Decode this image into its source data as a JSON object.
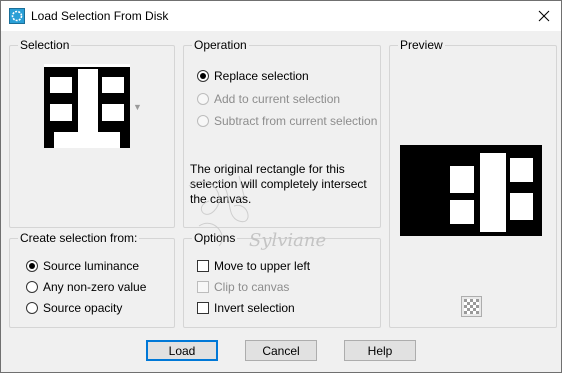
{
  "window": {
    "title": "Load Selection From Disk",
    "icon": "selection-dialog-icon"
  },
  "selection_group": {
    "label": "Selection"
  },
  "operation_group": {
    "label": "Operation",
    "options": [
      {
        "label": "Replace selection",
        "checked": true,
        "enabled": true
      },
      {
        "label": "Add to current selection",
        "checked": false,
        "enabled": false
      },
      {
        "label": "Subtract from current selection",
        "checked": false,
        "enabled": false
      }
    ],
    "info": "The original rectangle for this selection will completely intersect the canvas."
  },
  "preview_group": {
    "label": "Preview",
    "checker_icon": "transparency-checker-icon"
  },
  "create_group": {
    "label": "Create selection from:",
    "options": [
      {
        "label": "Source luminance",
        "checked": true
      },
      {
        "label": "Any non-zero value",
        "checked": false
      },
      {
        "label": "Source opacity",
        "checked": false
      }
    ]
  },
  "options_group": {
    "label": "Options",
    "items": [
      {
        "label": "Move to upper left",
        "checked": false,
        "enabled": true
      },
      {
        "label": "Clip to canvas",
        "checked": false,
        "enabled": false
      },
      {
        "label": "Invert selection",
        "checked": false,
        "enabled": true
      }
    ]
  },
  "buttons": {
    "load": "Load",
    "cancel": "Cancel",
    "help": "Help"
  },
  "watermark_text": "Sylviane",
  "colors": {
    "accent": "#0078d7",
    "border": "#d5d5d5",
    "disabled": "#8d8d8d"
  }
}
